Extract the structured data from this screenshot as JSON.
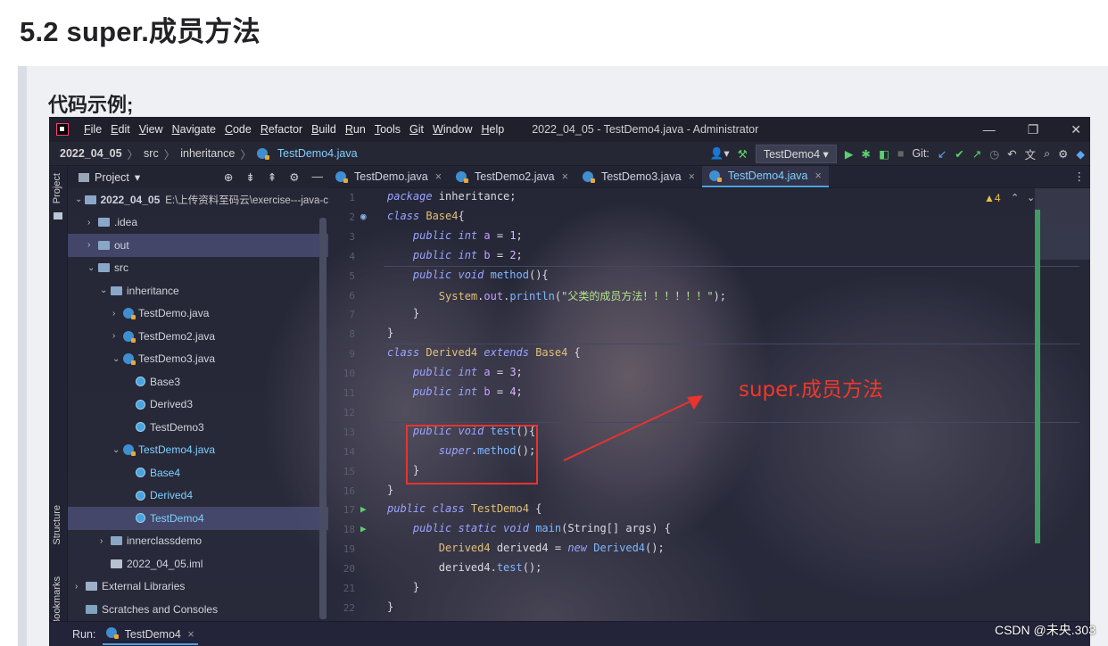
{
  "article": {
    "title": "5.2 super.成员方法",
    "code_label": "代码示例;"
  },
  "ide": {
    "menu": [
      "File",
      "Edit",
      "View",
      "Navigate",
      "Code",
      "Refactor",
      "Build",
      "Run",
      "Tools",
      "Git",
      "Window",
      "Help"
    ],
    "window_title": "2022_04_05 - TestDemo4.java - Administrator",
    "win_buttons": [
      "—",
      "❐",
      "✕"
    ],
    "breadcrumb": [
      "2022_04_05",
      "src",
      "inheritance",
      "TestDemo4.java"
    ],
    "run_config": "TestDemo4",
    "git_label": "Git:",
    "left_stripe": {
      "project": "Project",
      "structure": "Structure",
      "bookmarks": "Bookmarks"
    },
    "project_panel": {
      "title": "Project",
      "tree": [
        {
          "label": "2022_04_05",
          "extra": "E:\\上传资料至码云\\exercise---java-c",
          "indent": 0,
          "arrow": "⌄",
          "icon": "folder",
          "bold": true
        },
        {
          "label": ".idea",
          "indent": 1,
          "arrow": "›",
          "icon": "folder"
        },
        {
          "label": "out",
          "indent": 1,
          "arrow": "›",
          "icon": "folder",
          "selected": true
        },
        {
          "label": "src",
          "indent": 1,
          "arrow": "⌄",
          "icon": "folder"
        },
        {
          "label": "inheritance",
          "indent": 2,
          "arrow": "⌄",
          "icon": "folder"
        },
        {
          "label": "TestDemo.java",
          "indent": 3,
          "arrow": "›",
          "icon": "java"
        },
        {
          "label": "TestDemo2.java",
          "indent": 3,
          "arrow": "›",
          "icon": "java"
        },
        {
          "label": "TestDemo3.java",
          "indent": 3,
          "arrow": "⌄",
          "icon": "java"
        },
        {
          "label": "Base3",
          "indent": 4,
          "arrow": "",
          "icon": "class"
        },
        {
          "label": "Derived3",
          "indent": 4,
          "arrow": "",
          "icon": "class"
        },
        {
          "label": "TestDemo3",
          "indent": 4,
          "arrow": "",
          "icon": "class"
        },
        {
          "label": "TestDemo4.java",
          "indent": 3,
          "arrow": "⌄",
          "icon": "java",
          "cyan": true
        },
        {
          "label": "Base4",
          "indent": 4,
          "arrow": "",
          "icon": "class",
          "cyan": true
        },
        {
          "label": "Derived4",
          "indent": 4,
          "arrow": "",
          "icon": "class",
          "cyan": true
        },
        {
          "label": "TestDemo4",
          "indent": 4,
          "arrow": "",
          "icon": "class",
          "cyan": true,
          "selected": true
        },
        {
          "label": "innerclassdemo",
          "indent": 2,
          "arrow": "›",
          "icon": "folder"
        },
        {
          "label": "2022_04_05.iml",
          "indent": 2,
          "arrow": "",
          "icon": "iml"
        },
        {
          "label": "External Libraries",
          "indent": 0,
          "arrow": "›",
          "icon": "lib"
        },
        {
          "label": "Scratches and Consoles",
          "indent": 0,
          "arrow": "",
          "icon": "scratch"
        }
      ]
    },
    "tabs": [
      {
        "label": "TestDemo.java",
        "active": false
      },
      {
        "label": "TestDemo2.java",
        "active": false
      },
      {
        "label": "TestDemo3.java",
        "active": false
      },
      {
        "label": "TestDemo4.java",
        "active": true
      }
    ],
    "warnings": "▲4",
    "code_lines": [
      [
        [
          "kw",
          "package "
        ],
        [
          "pl",
          "inheritance;"
        ]
      ],
      [
        [
          "kw",
          "class "
        ],
        [
          "cls",
          "Base4"
        ],
        [
          "pl",
          "{"
        ]
      ],
      [
        [
          "pl",
          "    "
        ],
        [
          "kw",
          "public int "
        ],
        [
          "fld",
          "a"
        ],
        [
          "pl",
          " = "
        ],
        [
          "num",
          "1"
        ],
        [
          "pl",
          ";"
        ]
      ],
      [
        [
          "pl",
          "    "
        ],
        [
          "kw",
          "public int "
        ],
        [
          "fld",
          "b"
        ],
        [
          "pl",
          " = "
        ],
        [
          "num",
          "2"
        ],
        [
          "pl",
          ";"
        ]
      ],
      [
        [
          "pl",
          "    "
        ],
        [
          "kw",
          "public void "
        ],
        [
          "fn",
          "method"
        ],
        [
          "pl",
          "(){"
        ]
      ],
      [
        [
          "pl",
          "        "
        ],
        [
          "cls",
          "System"
        ],
        [
          "pl",
          "."
        ],
        [
          "fld",
          "out"
        ],
        [
          "pl",
          "."
        ],
        [
          "fn",
          "println"
        ],
        [
          "pl",
          "("
        ],
        [
          "str",
          "\"父类的成员方法！！！！！！\""
        ],
        [
          "pl",
          ");"
        ]
      ],
      [
        [
          "pl",
          "    }"
        ]
      ],
      [
        [
          "pl",
          "}"
        ]
      ],
      [
        [
          "kw",
          "class "
        ],
        [
          "cls",
          "Derived4 "
        ],
        [
          "kw",
          "extends "
        ],
        [
          "cls",
          "Base4 "
        ],
        [
          "pl",
          "{"
        ]
      ],
      [
        [
          "pl",
          "    "
        ],
        [
          "kw",
          "public int "
        ],
        [
          "fld",
          "a"
        ],
        [
          "pl",
          " = "
        ],
        [
          "num",
          "3"
        ],
        [
          "pl",
          ";"
        ]
      ],
      [
        [
          "pl",
          "    "
        ],
        [
          "kw",
          "public int "
        ],
        [
          "fld",
          "b"
        ],
        [
          "pl",
          " = "
        ],
        [
          "num",
          "4"
        ],
        [
          "pl",
          ";"
        ]
      ],
      [
        [
          "pl",
          ""
        ]
      ],
      [
        [
          "pl",
          "    "
        ],
        [
          "kw",
          "public void "
        ],
        [
          "fn",
          "test"
        ],
        [
          "pl",
          "(){"
        ]
      ],
      [
        [
          "pl",
          "        "
        ],
        [
          "kw",
          "super"
        ],
        [
          "pl",
          "."
        ],
        [
          "fn",
          "method"
        ],
        [
          "pl",
          "();"
        ]
      ],
      [
        [
          "pl",
          "    }"
        ]
      ],
      [
        [
          "pl",
          "}"
        ]
      ],
      [
        [
          "kw",
          "public class "
        ],
        [
          "cls",
          "TestDemo4 "
        ],
        [
          "pl",
          "{"
        ]
      ],
      [
        [
          "pl",
          "    "
        ],
        [
          "kw",
          "public static void "
        ],
        [
          "fn",
          "main"
        ],
        [
          "pl",
          "(String[] args) {"
        ]
      ],
      [
        [
          "pl",
          "        "
        ],
        [
          "cls",
          "Derived4 "
        ],
        [
          "pl",
          "derived4 = "
        ],
        [
          "kw",
          "new "
        ],
        [
          "fn",
          "Derived4"
        ],
        [
          "pl",
          "();"
        ]
      ],
      [
        [
          "pl",
          "        derived4."
        ],
        [
          "fn",
          "test"
        ],
        [
          "pl",
          "();"
        ]
      ],
      [
        [
          "pl",
          "    }"
        ]
      ],
      [
        [
          "pl",
          "}"
        ]
      ]
    ],
    "annotation": "super.成员方法",
    "bottom": {
      "run_label": "Run:",
      "run_tab": "TestDemo4"
    }
  },
  "watermark": "CSDN @未央.303"
}
